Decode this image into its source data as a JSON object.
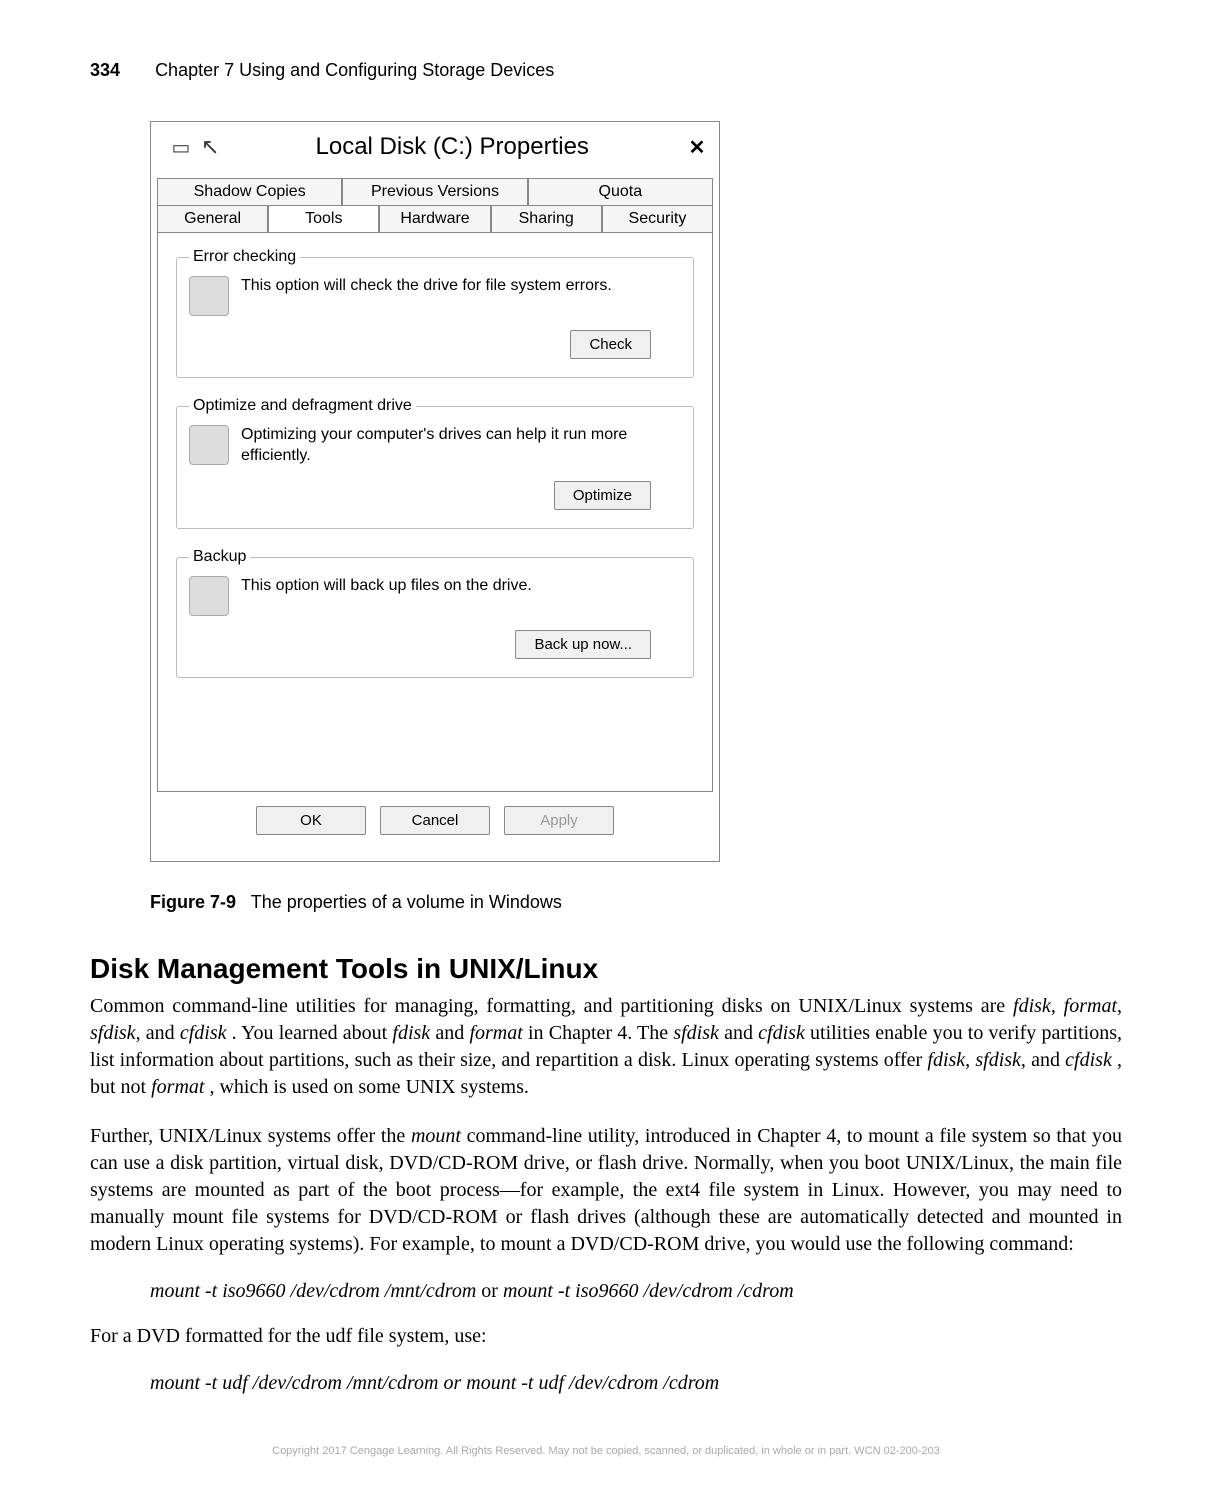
{
  "header": {
    "page_number": "334",
    "chapter": "Chapter 7   Using and Configuring Storage Devices"
  },
  "dialog": {
    "title": "Local Disk (C:) Properties",
    "close_glyph": "✕",
    "tabs_top": [
      "Shadow Copies",
      "Previous Versions",
      "Quota"
    ],
    "tabs_bottom": [
      "General",
      "Tools",
      "Hardware",
      "Sharing",
      "Security"
    ],
    "active_tab": "Tools",
    "groups": {
      "error_checking": {
        "legend": "Error checking",
        "text": "This option will check the drive for file system errors.",
        "button": "Check"
      },
      "optimize": {
        "legend": "Optimize and defragment drive",
        "text": "Optimizing your computer's drives can help it run more efficiently.",
        "button": "Optimize"
      },
      "backup": {
        "legend": "Backup",
        "text": "This option will back up files on the drive.",
        "button": "Back up now..."
      }
    },
    "buttons": {
      "ok": "OK",
      "cancel": "Cancel",
      "apply": "Apply"
    }
  },
  "figure_caption": {
    "label": "Figure 7-9",
    "text": "The properties of a volume in Windows"
  },
  "section": {
    "heading": "Disk Management Tools in UNIX/Linux",
    "p1_a": "Common command-line utilities for managing, formatting, and partitioning disks on UNIX/Linux systems are ",
    "p1_b": ". You learned about ",
    "p1_c": " in Chapter 4. The ",
    "p1_d": " utilities enable you to verify partitions, list information about partitions, such as their size, and repartition a disk. Linux operating systems offer ",
    "p1_e": ", but not ",
    "p1_f": ", which is used on some UNIX systems.",
    "i_fdisk": "fdisk",
    "i_format": "format",
    "i_sfdisk": "sfdisk",
    "i_cfdisk": "cfdisk",
    "i_and": " and ",
    "i_comma_and": ", and ",
    "i_comma": ", ",
    "p2_a": "Further, UNIX/Linux systems offer the ",
    "p2_mount": "mount",
    "p2_b": " command-line utility, introduced in Chapter 4, to mount a file system so that you can use a disk partition, virtual disk, DVD/CD-ROM drive, or flash drive. Normally, when you boot UNIX/Linux, the main file systems are mounted as part of the boot process—for example, the ext4 file system in Linux. However, you may need to manually mount file systems for DVD/CD-ROM or flash drives (although these are automatically detected and mounted in modern Linux operating systems). For example, to mount a DVD/CD-ROM drive, you would use the following command:",
    "cmd1_a": "mount -t iso9660 /dev/cdrom /mnt/cdrom",
    "cmd_or": " or ",
    "cmd1_b": "mount -t iso9660 /dev/cdrom /cdrom",
    "p3": "For a DVD formatted for the udf file system, use:",
    "cmd2_a": "mount -t udf /dev/cdrom /mnt/cdrom or mount -t udf /dev/cdrom /cdrom"
  },
  "copyright": "Copyright 2017 Cengage Learning. All Rights Reserved. May not be copied, scanned, or duplicated, in whole or in part.  WCN 02-200-203"
}
